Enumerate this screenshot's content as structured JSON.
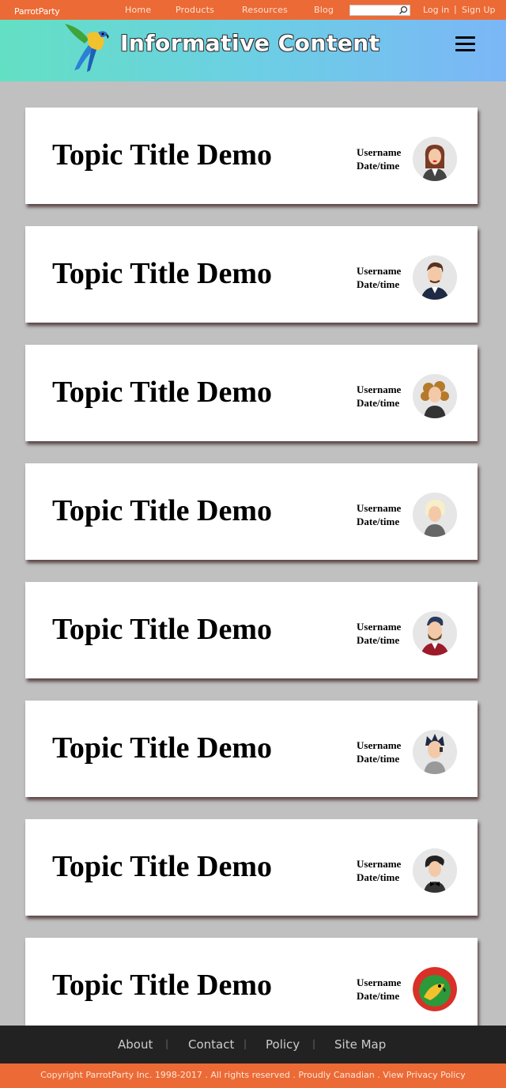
{
  "brand": {
    "logo_text": "ParrotParty",
    "site_title": "Informative Content"
  },
  "nav": {
    "items": [
      "Home",
      "Products",
      "Resources",
      "Blog"
    ],
    "search_placeholder": "",
    "login": "Log in",
    "divider": "|",
    "signup": "Sign Up"
  },
  "topics": [
    {
      "title": "Topic Title Demo",
      "username": "Username",
      "datetime": "Date/time",
      "avatar": "woman-brown-hair-avatar"
    },
    {
      "title": "Topic Title Demo",
      "username": "Username",
      "datetime": "Date/time",
      "avatar": "man-suit-avatar"
    },
    {
      "title": "Topic Title Demo",
      "username": "Username",
      "datetime": "Date/time",
      "avatar": "woman-curly-hair-avatar"
    },
    {
      "title": "Topic Title Demo",
      "username": "Username",
      "datetime": "Date/time",
      "avatar": "woman-blonde-avatar"
    },
    {
      "title": "Topic Title Demo",
      "username": "Username",
      "datetime": "Date/time",
      "avatar": "man-beard-avatar"
    },
    {
      "title": "Topic Title Demo",
      "username": "Username",
      "datetime": "Date/time",
      "avatar": "man-spiky-hair-avatar"
    },
    {
      "title": "Topic Title Demo",
      "username": "Username",
      "datetime": "Date/time",
      "avatar": "woman-bowtie-avatar"
    },
    {
      "title": "Topic Title Demo",
      "username": "Username",
      "datetime": "Date/time",
      "avatar": "parrot-avatar"
    }
  ],
  "footer": {
    "links": [
      "About",
      "Contact",
      "Policy",
      "Site Map"
    ],
    "divider": "|",
    "copyright": "Copyright ParrotParty Inc. 1998-2017 . All rights reserved . Proudly Canadian . View Privacy Policy"
  },
  "colors": {
    "topbar": "#ec6a35",
    "header_start": "#63e0c3",
    "header_end": "#7bb6f7",
    "page_bg": "#c0c0c0",
    "footer": "#222222"
  }
}
